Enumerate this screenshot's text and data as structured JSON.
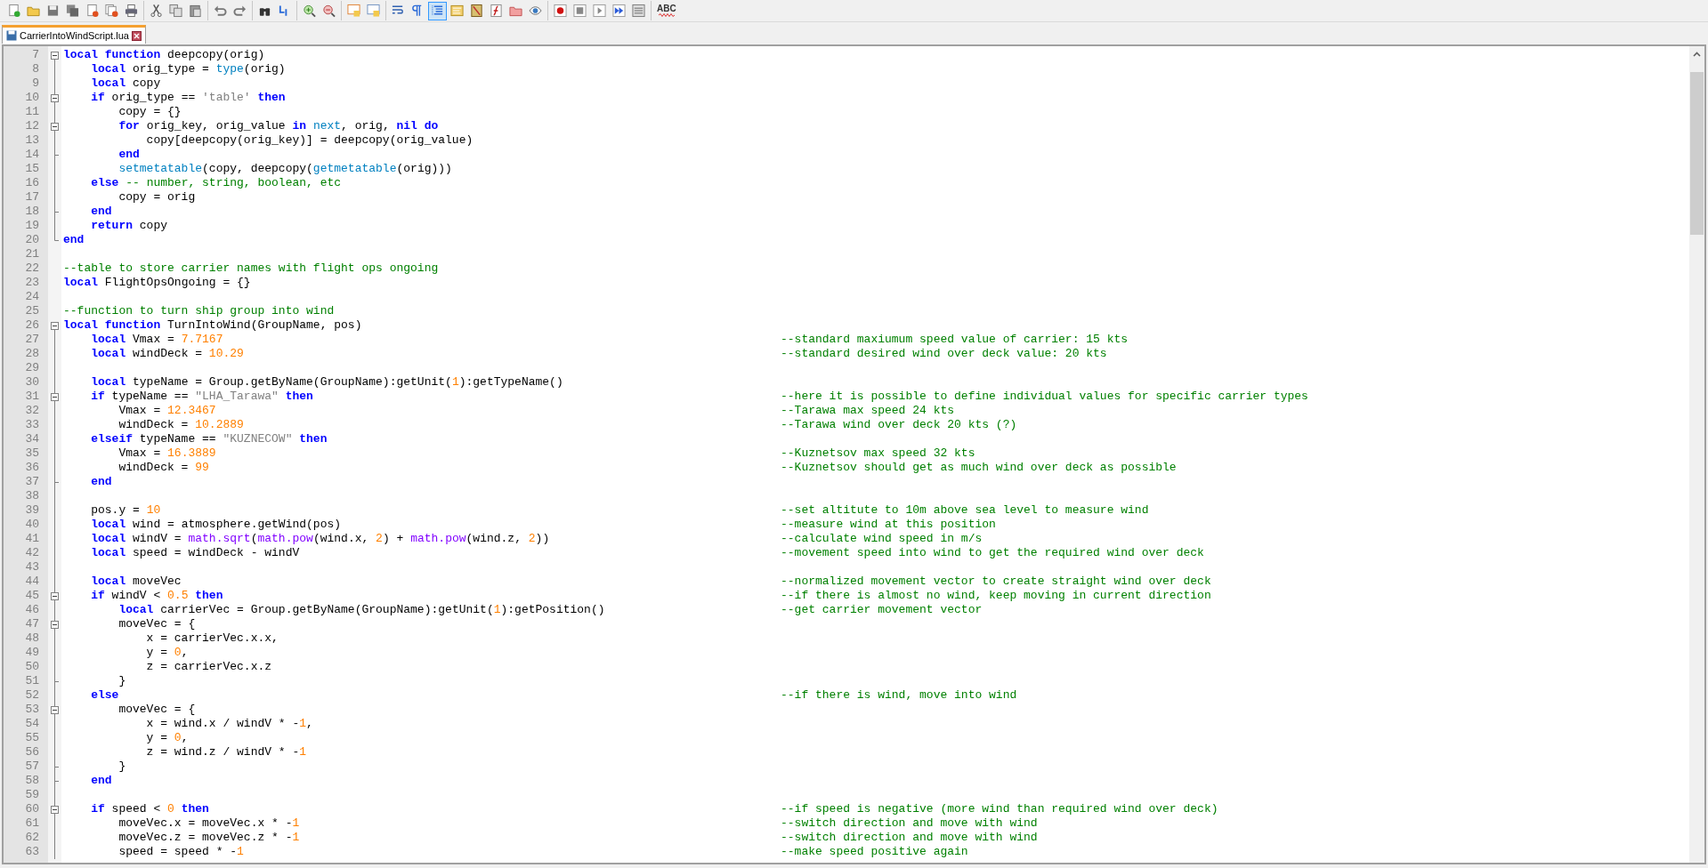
{
  "toolbar": {
    "groups": [
      [
        {
          "pressed": false
        },
        {
          "pressed": false
        },
        {
          "pressed": false
        },
        {
          "pressed": false
        },
        {
          "pressed": false
        },
        {
          "pressed": false
        },
        {
          "pressed": false
        }
      ],
      [
        {
          "pressed": false
        },
        {
          "pressed": false
        },
        {
          "pressed": false
        }
      ],
      [
        {
          "pressed": false
        },
        {
          "pressed": false
        }
      ],
      [
        {
          "pressed": false
        },
        {
          "pressed": false
        }
      ],
      [
        {
          "pressed": false
        },
        {
          "pressed": false
        }
      ],
      [
        {
          "pressed": false
        },
        {
          "pressed": false
        }
      ],
      [
        {
          "pressed": false
        },
        {
          "pressed": false
        },
        {
          "pressed": true
        },
        {
          "pressed": false
        },
        {
          "pressed": false
        },
        {
          "pressed": false
        },
        {
          "pressed": false
        },
        {
          "pressed": false
        }
      ],
      [
        {
          "pressed": false
        },
        {
          "pressed": false
        },
        {
          "pressed": false
        },
        {
          "pressed": false
        },
        {
          "pressed": false
        }
      ],
      [
        {
          "pressed": false,
          "label": "ABC"
        }
      ]
    ]
  },
  "tabs": [
    {
      "label": "CarrierIntoWindScript.lua",
      "selected": true
    }
  ],
  "editor": {
    "lines": [
      {
        "number": "7",
        "fold_start": true,
        "fold_end": false,
        "code": [
          {
            "kind": "kw",
            "text": "local function"
          },
          {
            "kind": "plain",
            "text": " deepcopy(orig)"
          }
        ]
      },
      {
        "number": "8",
        "fold_start": false,
        "fold_end": false,
        "code": [
          {
            "kind": "kw",
            "text": "    local"
          },
          {
            "kind": "plain",
            "text": " orig_type = "
          },
          {
            "kind": "fn",
            "text": "type"
          },
          {
            "kind": "plain",
            "text": "(orig)"
          }
        ]
      },
      {
        "number": "9",
        "fold_start": false,
        "fold_end": false,
        "code": [
          {
            "kind": "kw",
            "text": "    local"
          },
          {
            "kind": "plain",
            "text": " copy"
          }
        ]
      },
      {
        "number": "10",
        "fold_start": true,
        "fold_end": false,
        "code": [
          {
            "kind": "kw",
            "text": "    if"
          },
          {
            "kind": "plain",
            "text": " orig_type == "
          },
          {
            "kind": "str",
            "text": "'table'"
          },
          {
            "kind": "kw",
            "text": " then"
          }
        ]
      },
      {
        "number": "11",
        "fold_start": false,
        "fold_end": false,
        "code": [
          {
            "kind": "plain",
            "text": "        copy = {}"
          }
        ]
      },
      {
        "number": "12",
        "fold_start": true,
        "fold_end": false,
        "code": [
          {
            "kind": "kw",
            "text": "        for"
          },
          {
            "kind": "plain",
            "text": " orig_key, orig_value "
          },
          {
            "kind": "kw",
            "text": "in"
          },
          {
            "kind": "fn",
            "text": " next"
          },
          {
            "kind": "plain",
            "text": ", orig, "
          },
          {
            "kind": "kw",
            "text": "nil do"
          }
        ]
      },
      {
        "number": "13",
        "fold_start": false,
        "fold_end": false,
        "code": [
          {
            "kind": "plain",
            "text": "            copy[deepcopy(orig_key)] = deepcopy(orig_value)"
          }
        ]
      },
      {
        "number": "14",
        "fold_start": false,
        "fold_end": true,
        "code": [
          {
            "kind": "kw",
            "text": "        end"
          }
        ]
      },
      {
        "number": "15",
        "fold_start": false,
        "fold_end": false,
        "code": [
          {
            "kind": "fn",
            "text": "        setmetatable"
          },
          {
            "kind": "plain",
            "text": "(copy, deepcopy("
          },
          {
            "kind": "fn",
            "text": "getmetatable"
          },
          {
            "kind": "plain",
            "text": "(orig)))"
          }
        ]
      },
      {
        "number": "16",
        "fold_start": false,
        "fold_end": false,
        "code": [
          {
            "kind": "kw",
            "text": "    else"
          },
          {
            "kind": "cmt",
            "text": " -- number, string, boolean, etc"
          }
        ]
      },
      {
        "number": "17",
        "fold_start": false,
        "fold_end": false,
        "code": [
          {
            "kind": "plain",
            "text": "        copy = orig"
          }
        ]
      },
      {
        "number": "18",
        "fold_start": false,
        "fold_end": true,
        "code": [
          {
            "kind": "kw",
            "text": "    end"
          }
        ]
      },
      {
        "number": "19",
        "fold_start": false,
        "fold_end": false,
        "code": [
          {
            "kind": "kw",
            "text": "    return"
          },
          {
            "kind": "plain",
            "text": " copy"
          }
        ]
      },
      {
        "number": "20",
        "fold_start": false,
        "fold_end": true,
        "code": [
          {
            "kind": "kw",
            "text": "end"
          }
        ]
      },
      {
        "number": "21",
        "fold_start": false,
        "fold_end": false
      },
      {
        "number": "22",
        "fold_start": false,
        "fold_end": false,
        "code": [
          {
            "kind": "cmt",
            "text": "--table to store carrier names with flight ops ongoing"
          }
        ]
      },
      {
        "number": "23",
        "fold_start": false,
        "fold_end": false,
        "code": [
          {
            "kind": "kw",
            "text": "local"
          },
          {
            "kind": "plain",
            "text": " FlightOpsOngoing = {}"
          }
        ]
      },
      {
        "number": "24",
        "fold_start": false,
        "fold_end": false
      },
      {
        "number": "25",
        "fold_start": false,
        "fold_end": false,
        "code": [
          {
            "kind": "cmt",
            "text": "--function to turn ship group into wind"
          }
        ]
      },
      {
        "number": "26",
        "fold_start": true,
        "fold_end": false,
        "code": [
          {
            "kind": "kw",
            "text": "local function"
          },
          {
            "kind": "plain",
            "text": " TurnIntoWind(GroupName, pos)"
          }
        ]
      },
      {
        "number": "27",
        "fold_start": false,
        "fold_end": false,
        "code": [
          {
            "kind": "kw",
            "text": "    local"
          },
          {
            "kind": "plain",
            "text": " Vmax = "
          },
          {
            "kind": "num",
            "text": "7.7167"
          }
        ],
        "comment": "--standard maxiumum speed value of carrier: 15 kts"
      },
      {
        "number": "28",
        "fold_start": false,
        "fold_end": false,
        "code": [
          {
            "kind": "kw",
            "text": "    local"
          },
          {
            "kind": "plain",
            "text": " windDeck = "
          },
          {
            "kind": "num",
            "text": "10.29"
          }
        ],
        "comment": "--standard desired wind over deck value: 20 kts"
      },
      {
        "number": "29",
        "fold_start": false,
        "fold_end": false
      },
      {
        "number": "30",
        "fold_start": false,
        "fold_end": false,
        "code": [
          {
            "kind": "kw",
            "text": "    local"
          },
          {
            "kind": "plain",
            "text": " typeName = Group.getByName(GroupName):getUnit("
          },
          {
            "kind": "num",
            "text": "1"
          },
          {
            "kind": "plain",
            "text": "):getTypeName()"
          }
        ]
      },
      {
        "number": "31",
        "fold_start": true,
        "fold_end": false,
        "code": [
          {
            "kind": "kw",
            "text": "    if"
          },
          {
            "kind": "plain",
            "text": " typeName == "
          },
          {
            "kind": "str",
            "text": "\"LHA_Tarawa\""
          },
          {
            "kind": "kw",
            "text": " then"
          }
        ],
        "comment": "--here it is possible to define individual values for specific carrier types"
      },
      {
        "number": "32",
        "fold_start": false,
        "fold_end": false,
        "code": [
          {
            "kind": "plain",
            "text": "        Vmax = "
          },
          {
            "kind": "num",
            "text": "12.3467"
          }
        ],
        "comment": "--Tarawa max speed 24 kts"
      },
      {
        "number": "33",
        "fold_start": false,
        "fold_end": false,
        "code": [
          {
            "kind": "plain",
            "text": "        windDeck = "
          },
          {
            "kind": "num",
            "text": "10.2889"
          }
        ],
        "comment": "--Tarawa wind over deck 20 kts (?)"
      },
      {
        "number": "34",
        "fold_start": false,
        "fold_end": false,
        "code": [
          {
            "kind": "kw",
            "text": "    elseif"
          },
          {
            "kind": "plain",
            "text": " typeName == "
          },
          {
            "kind": "str",
            "text": "\"KUZNECOW\""
          },
          {
            "kind": "kw",
            "text": " then"
          }
        ]
      },
      {
        "number": "35",
        "fold_start": false,
        "fold_end": false,
        "code": [
          {
            "kind": "plain",
            "text": "        Vmax = "
          },
          {
            "kind": "num",
            "text": "16.3889"
          }
        ],
        "comment": "--Kuznetsov max speed 32 kts"
      },
      {
        "number": "36",
        "fold_start": false,
        "fold_end": false,
        "code": [
          {
            "kind": "plain",
            "text": "        windDeck = "
          },
          {
            "kind": "num",
            "text": "99"
          }
        ],
        "comment": "--Kuznetsov should get as much wind over deck as possible"
      },
      {
        "number": "37",
        "fold_start": false,
        "fold_end": true,
        "code": [
          {
            "kind": "kw",
            "text": "    end"
          }
        ]
      },
      {
        "number": "38",
        "fold_start": false,
        "fold_end": false
      },
      {
        "number": "39",
        "fold_start": false,
        "fold_end": false,
        "code": [
          {
            "kind": "plain",
            "text": "    pos.y = "
          },
          {
            "kind": "num",
            "text": "10"
          }
        ],
        "comment": "--set altitute to 10m above sea level to measure wind"
      },
      {
        "number": "40",
        "fold_start": false,
        "fold_end": false,
        "code": [
          {
            "kind": "kw",
            "text": "    local"
          },
          {
            "kind": "plain",
            "text": " wind = atmosphere.getWind(pos)"
          }
        ],
        "comment": "--measure wind at this position"
      },
      {
        "number": "41",
        "fold_start": false,
        "fold_end": false,
        "code": [
          {
            "kind": "kw",
            "text": "    local"
          },
          {
            "kind": "plain",
            "text": " windV = "
          },
          {
            "kind": "lib",
            "text": "math.sqrt"
          },
          {
            "kind": "plain",
            "text": "("
          },
          {
            "kind": "lib",
            "text": "math.pow"
          },
          {
            "kind": "plain",
            "text": "(wind.x, "
          },
          {
            "kind": "num",
            "text": "2"
          },
          {
            "kind": "plain",
            "text": ") + "
          },
          {
            "kind": "lib",
            "text": "math.pow"
          },
          {
            "kind": "plain",
            "text": "(wind.z, "
          },
          {
            "kind": "num",
            "text": "2"
          },
          {
            "kind": "plain",
            "text": "))"
          }
        ],
        "comment": "--calculate wind speed in m/s"
      },
      {
        "number": "42",
        "fold_start": false,
        "fold_end": false,
        "code": [
          {
            "kind": "kw",
            "text": "    local"
          },
          {
            "kind": "plain",
            "text": " speed = windDeck - windV"
          }
        ],
        "comment": "--movement speed into wind to get the required wind over deck"
      },
      {
        "number": "43",
        "fold_start": false,
        "fold_end": false
      },
      {
        "number": "44",
        "fold_start": false,
        "fold_end": false,
        "code": [
          {
            "kind": "kw",
            "text": "    local"
          },
          {
            "kind": "plain",
            "text": " moveVec"
          }
        ],
        "comment": "--normalized movement vector to create straight wind over deck"
      },
      {
        "number": "45",
        "fold_start": true,
        "fold_end": false,
        "code": [
          {
            "kind": "kw",
            "text": "    if"
          },
          {
            "kind": "plain",
            "text": " windV < "
          },
          {
            "kind": "num",
            "text": "0.5"
          },
          {
            "kind": "kw",
            "text": " then"
          }
        ],
        "comment": "--if there is almost no wind, keep moving in current direction"
      },
      {
        "number": "46",
        "fold_start": false,
        "fold_end": false,
        "code": [
          {
            "kind": "kw",
            "text": "        local"
          },
          {
            "kind": "plain",
            "text": " carrierVec = Group.getByName(GroupName):getUnit("
          },
          {
            "kind": "num",
            "text": "1"
          },
          {
            "kind": "plain",
            "text": "):getPosition()"
          }
        ],
        "comment": "--get carrier movement vector"
      },
      {
        "number": "47",
        "fold_start": true,
        "fold_end": false,
        "code": [
          {
            "kind": "plain",
            "text": "        moveVec = {"
          }
        ]
      },
      {
        "number": "48",
        "fold_start": false,
        "fold_end": false,
        "code": [
          {
            "kind": "plain",
            "text": "            x = carrierVec.x.x,"
          }
        ]
      },
      {
        "number": "49",
        "fold_start": false,
        "fold_end": false,
        "code": [
          {
            "kind": "plain",
            "text": "            y = "
          },
          {
            "kind": "num",
            "text": "0"
          },
          {
            "kind": "plain",
            "text": ","
          }
        ]
      },
      {
        "number": "50",
        "fold_start": false,
        "fold_end": false,
        "code": [
          {
            "kind": "plain",
            "text": "            z = carrierVec.x.z"
          }
        ]
      },
      {
        "number": "51",
        "fold_start": false,
        "fold_end": true,
        "code": [
          {
            "kind": "plain",
            "text": "        }"
          }
        ]
      },
      {
        "number": "52",
        "fold_start": false,
        "fold_end": false,
        "code": [
          {
            "kind": "kw",
            "text": "    else"
          }
        ],
        "comment": "--if there is wind, move into wind"
      },
      {
        "number": "53",
        "fold_start": true,
        "fold_end": false,
        "code": [
          {
            "kind": "plain",
            "text": "        moveVec = {"
          }
        ]
      },
      {
        "number": "54",
        "fold_start": false,
        "fold_end": false,
        "code": [
          {
            "kind": "plain",
            "text": "            x = wind.x / windV * -"
          },
          {
            "kind": "num",
            "text": "1"
          },
          {
            "kind": "plain",
            "text": ","
          }
        ]
      },
      {
        "number": "55",
        "fold_start": false,
        "fold_end": false,
        "code": [
          {
            "kind": "plain",
            "text": "            y = "
          },
          {
            "kind": "num",
            "text": "0"
          },
          {
            "kind": "plain",
            "text": ","
          }
        ]
      },
      {
        "number": "56",
        "fold_start": false,
        "fold_end": false,
        "code": [
          {
            "kind": "plain",
            "text": "            z = wind.z / windV * -"
          },
          {
            "kind": "num",
            "text": "1"
          }
        ]
      },
      {
        "number": "57",
        "fold_start": false,
        "fold_end": true,
        "code": [
          {
            "kind": "plain",
            "text": "        }"
          }
        ]
      },
      {
        "number": "58",
        "fold_start": false,
        "fold_end": true,
        "code": [
          {
            "kind": "kw",
            "text": "    end"
          }
        ]
      },
      {
        "number": "59",
        "fold_start": false,
        "fold_end": false
      },
      {
        "number": "60",
        "fold_start": true,
        "fold_end": false,
        "code": [
          {
            "kind": "kw",
            "text": "    if"
          },
          {
            "kind": "plain",
            "text": " speed < "
          },
          {
            "kind": "num",
            "text": "0"
          },
          {
            "kind": "kw",
            "text": " then"
          }
        ],
        "comment": "--if speed is negative (more wind than required wind over deck)"
      },
      {
        "number": "61",
        "fold_start": false,
        "fold_end": false,
        "code": [
          {
            "kind": "plain",
            "text": "        moveVec.x = moveVec.x * -"
          },
          {
            "kind": "num",
            "text": "1"
          }
        ],
        "comment": "--switch direction and move with wind"
      },
      {
        "number": "62",
        "fold_start": false,
        "fold_end": false,
        "code": [
          {
            "kind": "plain",
            "text": "        moveVec.z = moveVec.z * -"
          },
          {
            "kind": "num",
            "text": "1"
          }
        ],
        "comment": "--switch direction and move with wind"
      },
      {
        "number": "63",
        "fold_start": false,
        "fold_end": false,
        "code": [
          {
            "kind": "plain",
            "text": "        speed = speed * -"
          },
          {
            "kind": "num",
            "text": "1"
          }
        ],
        "comment": "--make speed positive again"
      }
    ]
  }
}
